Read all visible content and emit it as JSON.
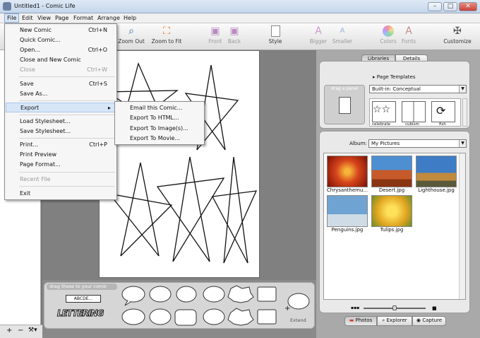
{
  "window": {
    "title": "Untitled1 - Comic Life",
    "min": "–",
    "max": "□",
    "close": "✕",
    "close_color": "#c7423a"
  },
  "menubar": [
    "File",
    "Edit",
    "View",
    "Page",
    "Format",
    "Arrange",
    "Help"
  ],
  "toolbar": {
    "zoom_out": "Zoom Out",
    "zoom_fit": "Zoom to Fit",
    "front": "Front",
    "back": "Back",
    "style": "Style",
    "bigger": "Bigger",
    "smaller": "Smaller",
    "colors": "Colors",
    "fonts": "Fonts",
    "customize": "Customize"
  },
  "file_menu": [
    {
      "label": "New Comic",
      "shortcut": "Ctrl+N",
      "enabled": true
    },
    {
      "label": "Quick Comic...",
      "shortcut": "",
      "enabled": true
    },
    {
      "label": "Open...",
      "shortcut": "Ctrl+O",
      "enabled": true
    },
    {
      "label": "Close and New Comic",
      "shortcut": "",
      "enabled": true
    },
    {
      "label": "Close",
      "shortcut": "Ctrl+W",
      "enabled": false
    },
    {
      "label": "Save",
      "shortcut": "Ctrl+S",
      "enabled": true
    },
    {
      "label": "Save As...",
      "shortcut": "",
      "enabled": true
    },
    {
      "label": "Export",
      "shortcut": "▸",
      "enabled": true
    },
    {
      "label": "Load Stylesheet...",
      "shortcut": "",
      "enabled": true
    },
    {
      "label": "Save Stylesheet...",
      "shortcut": "",
      "enabled": true
    },
    {
      "label": "Print...",
      "shortcut": "Ctrl+P",
      "enabled": true
    },
    {
      "label": "Print Preview",
      "shortcut": "",
      "enabled": true
    },
    {
      "label": "Page Format...",
      "shortcut": "",
      "enabled": true
    },
    {
      "label": "Recent File",
      "shortcut": "",
      "enabled": false
    },
    {
      "label": "Exit",
      "shortcut": "",
      "enabled": true
    }
  ],
  "export_menu": [
    "Email this Comic...",
    "Export To HTML...",
    "Export To Image(s)...",
    "Export To Movie..."
  ],
  "left_toolbar": {
    "add": "+",
    "remove": "−",
    "tools": "⚒▾"
  },
  "balloon_panel": {
    "caption": "drag these to your comic",
    "lettering": "LETTERING",
    "abcde": "ABCDE...",
    "extend": "Extend"
  },
  "right_panel": {
    "tabs": [
      "Libraries",
      "Details"
    ],
    "page_templates": "Page Templates",
    "drag_panel": "drag a panel",
    "template_set": "Built-in: Conceptual",
    "thumb_labels": [
      "celebrate",
      "cubism",
      "fish"
    ],
    "album_label": "Album:",
    "album_value": "My Pictures",
    "photos": [
      {
        "name": "Chrysanthemu...",
        "color": "#c8331a"
      },
      {
        "name": "Desert.jpg",
        "color": "#b9512a"
      },
      {
        "name": "Lighthouse.jpg",
        "color": "#4e86c4"
      },
      {
        "name": "Penguins.jpg",
        "color": "#6e9bc4"
      },
      {
        "name": "Tulips.jpg",
        "color": "#e1b22a"
      }
    ],
    "bottom_tabs": [
      "Photos",
      "Explorer",
      "Capture"
    ],
    "zoom_slider": 0.5
  }
}
